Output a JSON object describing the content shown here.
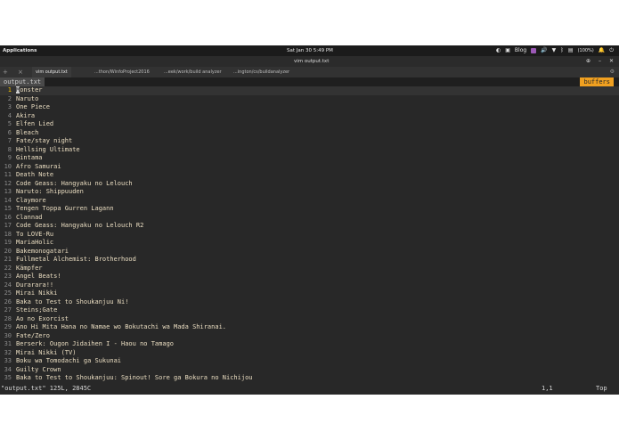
{
  "topbar": {
    "applications": "Applications",
    "clock": "Sat Jan 30     5:49 PM",
    "tray": {
      "blog_label": "Blog",
      "battery_pct": "(100%)"
    }
  },
  "window": {
    "title": "vim output.txt"
  },
  "tabs": [
    {
      "label": "vim output.txt"
    },
    {
      "label": "...thon/WinfoProject2016"
    },
    {
      "label": "...eek/work/build analyzer"
    },
    {
      "label": "...ington/cs/buildanalyzer"
    }
  ],
  "vim": {
    "filename_tab": "output.txt",
    "buffers_label": "buffers",
    "lines": [
      {
        "n": "1",
        "text": "Monster"
      },
      {
        "n": "2",
        "text": "Naruto"
      },
      {
        "n": "3",
        "text": "One Piece"
      },
      {
        "n": "4",
        "text": "Akira"
      },
      {
        "n": "5",
        "text": "Elfen Lied"
      },
      {
        "n": "6",
        "text": "Bleach"
      },
      {
        "n": "7",
        "text": "Fate/stay night"
      },
      {
        "n": "8",
        "text": "Hellsing Ultimate"
      },
      {
        "n": "9",
        "text": "Gintama"
      },
      {
        "n": "10",
        "text": "Afro Samurai"
      },
      {
        "n": "11",
        "text": "Death Note"
      },
      {
        "n": "12",
        "text": "Code Geass: Hangyaku no Lelouch"
      },
      {
        "n": "13",
        "text": "Naruto: Shippuuden"
      },
      {
        "n": "14",
        "text": "Claymore"
      },
      {
        "n": "15",
        "text": "Tengen Toppa Gurren Lagann"
      },
      {
        "n": "16",
        "text": "Clannad"
      },
      {
        "n": "17",
        "text": "Code Geass: Hangyaku no Lelouch R2"
      },
      {
        "n": "18",
        "text": "To LOVE-Ru"
      },
      {
        "n": "19",
        "text": "MariaHolic"
      },
      {
        "n": "20",
        "text": "Bakemonogatari"
      },
      {
        "n": "21",
        "text": "Fullmetal Alchemist: Brotherhood"
      },
      {
        "n": "22",
        "text": "Kämpfer"
      },
      {
        "n": "23",
        "text": "Angel Beats!"
      },
      {
        "n": "24",
        "text": "Durarara!!"
      },
      {
        "n": "25",
        "text": "Mirai Nikki"
      },
      {
        "n": "26",
        "text": "Baka to Test to Shoukanjuu Ni!"
      },
      {
        "n": "27",
        "text": "Steins;Gate"
      },
      {
        "n": "28",
        "text": "Ao no Exorcist"
      },
      {
        "n": "29",
        "text": "Ano Hi Mita Hana no Namae wo Bokutachi wa Mada Shiranai."
      },
      {
        "n": "30",
        "text": "Fate/Zero"
      },
      {
        "n": "31",
        "text": "Berserk: Ougon Jidaihen I - Haou no Tamago"
      },
      {
        "n": "32",
        "text": "Mirai Nikki (TV)"
      },
      {
        "n": "33",
        "text": "Boku wa Tomodachi ga Sukunai"
      },
      {
        "n": "34",
        "text": "Guilty Crown"
      },
      {
        "n": "35",
        "text": "Baka to Test to Shoukanjuu: Spinout! Sore ga Bokura no Nichijou"
      }
    ],
    "status_message": "\"output.txt\" 125L, 2845C",
    "cursor_pos": "1,1",
    "scroll_pos": "Top"
  },
  "colors": {
    "terminal_bg": "#282828",
    "text": "#e9dcc0",
    "line_number": "#8a8a8a",
    "buffers_accent": "#f0a020"
  }
}
